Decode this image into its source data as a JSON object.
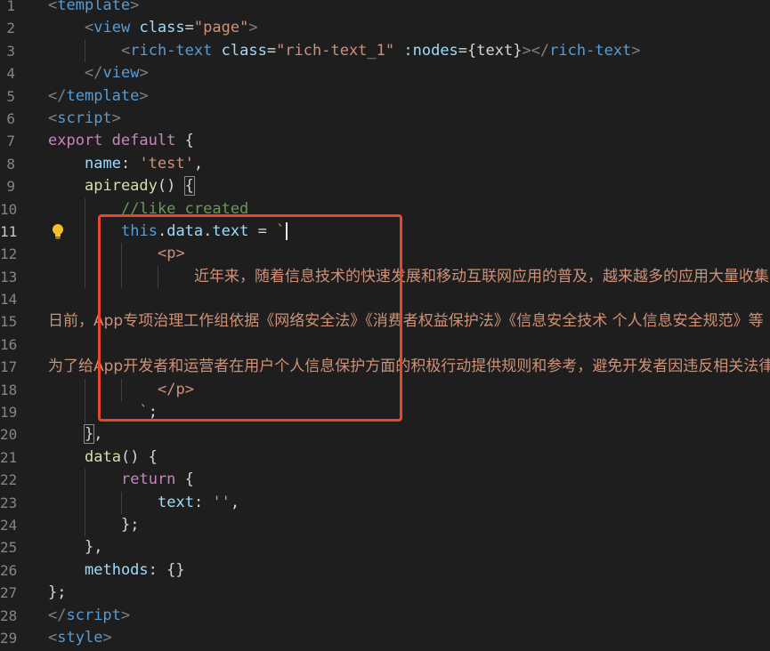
{
  "lines": [
    {
      "n": "1",
      "indent": 0,
      "tokens": [
        [
          "t-punc",
          "<"
        ],
        [
          "t-tag",
          "template"
        ],
        [
          "t-punc",
          ">"
        ]
      ]
    },
    {
      "n": "2",
      "indent": 1,
      "tokens": [
        [
          "t-punc",
          "<"
        ],
        [
          "t-tag",
          "view"
        ],
        [
          "t-txt",
          " "
        ],
        [
          "t-attr",
          "class"
        ],
        [
          "t-txt",
          "="
        ],
        [
          "t-str",
          "\"page\""
        ],
        [
          "t-punc",
          ">"
        ]
      ]
    },
    {
      "n": "3",
      "indent": 2,
      "tokens": [
        [
          "t-punc",
          "<"
        ],
        [
          "t-tag",
          "rich-text"
        ],
        [
          "t-txt",
          " "
        ],
        [
          "t-attr",
          "class"
        ],
        [
          "t-txt",
          "="
        ],
        [
          "t-str",
          "\"rich-text_1\""
        ],
        [
          "t-txt",
          " "
        ],
        [
          "t-attr",
          ":nodes"
        ],
        [
          "t-txt",
          "={text}"
        ],
        [
          "t-punc",
          "></"
        ],
        [
          "t-tag",
          "rich-text"
        ],
        [
          "t-punc",
          ">"
        ]
      ]
    },
    {
      "n": "4",
      "indent": 1,
      "tokens": [
        [
          "t-punc",
          "</"
        ],
        [
          "t-tag",
          "view"
        ],
        [
          "t-punc",
          ">"
        ]
      ]
    },
    {
      "n": "5",
      "indent": 0,
      "tokens": [
        [
          "t-punc",
          "</"
        ],
        [
          "t-tag",
          "template"
        ],
        [
          "t-punc",
          ">"
        ]
      ]
    },
    {
      "n": "6",
      "indent": 0,
      "tokens": [
        [
          "t-punc",
          "<"
        ],
        [
          "t-tag",
          "script"
        ],
        [
          "t-punc",
          ">"
        ]
      ]
    },
    {
      "n": "7",
      "indent": 0,
      "tokens": [
        [
          "t-kw",
          "export"
        ],
        [
          "t-txt",
          " "
        ],
        [
          "t-kw",
          "default"
        ],
        [
          "t-txt",
          " {"
        ]
      ]
    },
    {
      "n": "8",
      "indent": 1,
      "tokens": [
        [
          "t-prop",
          "name"
        ],
        [
          "t-txt",
          ": "
        ],
        [
          "t-str",
          "'test'"
        ],
        [
          "t-txt",
          ","
        ]
      ]
    },
    {
      "n": "9",
      "indent": 1,
      "tokens": [
        [
          "t-fn",
          "apiready"
        ],
        [
          "t-txt",
          "() "
        ],
        [
          "bracket-box",
          "{"
        ]
      ]
    },
    {
      "n": "10",
      "indent": 2,
      "tokens": [
        [
          "t-comment",
          "//like created"
        ]
      ]
    },
    {
      "n": "11",
      "indent": 2,
      "active": true,
      "bulb": true,
      "cursor": true,
      "tokens": [
        [
          "t-this",
          "this"
        ],
        [
          "t-txt",
          "."
        ],
        [
          "t-prop",
          "data"
        ],
        [
          "t-txt",
          "."
        ],
        [
          "t-prop",
          "text"
        ],
        [
          "t-txt",
          " = "
        ],
        [
          "t-tpl",
          "`"
        ]
      ]
    },
    {
      "n": "12",
      "indent": 3,
      "tokens": [
        [
          "t-tpl",
          "<p>"
        ]
      ]
    },
    {
      "n": "13",
      "indent": 4,
      "tokens": [
        [
          "t-cjk",
          "近年来，随着信息技术的快速发展和移动互联网应用的普及，越来越多的应用大量收集、"
        ]
      ]
    },
    {
      "n": "14",
      "indent": 0,
      "tokens": []
    },
    {
      "n": "15",
      "indent": 0,
      "tokens": [
        [
          "t-cjk",
          "日前，App专项治理工作组依据《网络安全法》《消费者权益保护法》《信息安全技术 个人信息安全规范》等"
        ]
      ]
    },
    {
      "n": "16",
      "indent": 0,
      "tokens": []
    },
    {
      "n": "17",
      "indent": 0,
      "tokens": [
        [
          "t-cjk",
          "为了给App开发者和运营者在用户个人信息保护方面的积极行动提供规则和参考，避免开发者因违反相关法律"
        ]
      ]
    },
    {
      "n": "18",
      "indent": 3,
      "tokens": [
        [
          "t-tpl",
          "</p>"
        ]
      ]
    },
    {
      "n": "19",
      "indent": 2,
      "tokens": [
        [
          "t-tpl",
          "  `"
        ],
        [
          "t-txt",
          ";"
        ]
      ]
    },
    {
      "n": "20",
      "indent": 1,
      "tokens": [
        [
          "bracket-box",
          "}"
        ],
        [
          "t-txt",
          ","
        ]
      ]
    },
    {
      "n": "21",
      "indent": 1,
      "tokens": [
        [
          "t-fn",
          "data"
        ],
        [
          "t-txt",
          "() {"
        ]
      ]
    },
    {
      "n": "22",
      "indent": 2,
      "tokens": [
        [
          "t-kw",
          "return"
        ],
        [
          "t-txt",
          " {"
        ]
      ]
    },
    {
      "n": "23",
      "indent": 3,
      "tokens": [
        [
          "t-prop",
          "text"
        ],
        [
          "t-txt",
          ": "
        ],
        [
          "t-str",
          "''"
        ],
        [
          "t-txt",
          ","
        ]
      ]
    },
    {
      "n": "24",
      "indent": 2,
      "tokens": [
        [
          "t-txt",
          "};"
        ]
      ]
    },
    {
      "n": "25",
      "indent": 1,
      "tokens": [
        [
          "t-txt",
          "},"
        ]
      ]
    },
    {
      "n": "26",
      "indent": 1,
      "tokens": [
        [
          "t-prop",
          "methods"
        ],
        [
          "t-txt",
          ": {}"
        ]
      ]
    },
    {
      "n": "27",
      "indent": 0,
      "tokens": [
        [
          "t-txt",
          "};"
        ]
      ]
    },
    {
      "n": "28",
      "indent": 0,
      "tokens": [
        [
          "t-punc",
          "</"
        ],
        [
          "t-tag",
          "script"
        ],
        [
          "t-punc",
          ">"
        ]
      ]
    },
    {
      "n": "29",
      "indent": 0,
      "tokens": [
        [
          "t-punc",
          "<"
        ],
        [
          "t-tag",
          "style"
        ],
        [
          "t-punc",
          ">"
        ]
      ]
    }
  ],
  "icons": {
    "gutter_hint": "lightbulb-icon"
  },
  "colors": {
    "highlight_box": "#e8472c",
    "background": "#1e1e1e"
  }
}
